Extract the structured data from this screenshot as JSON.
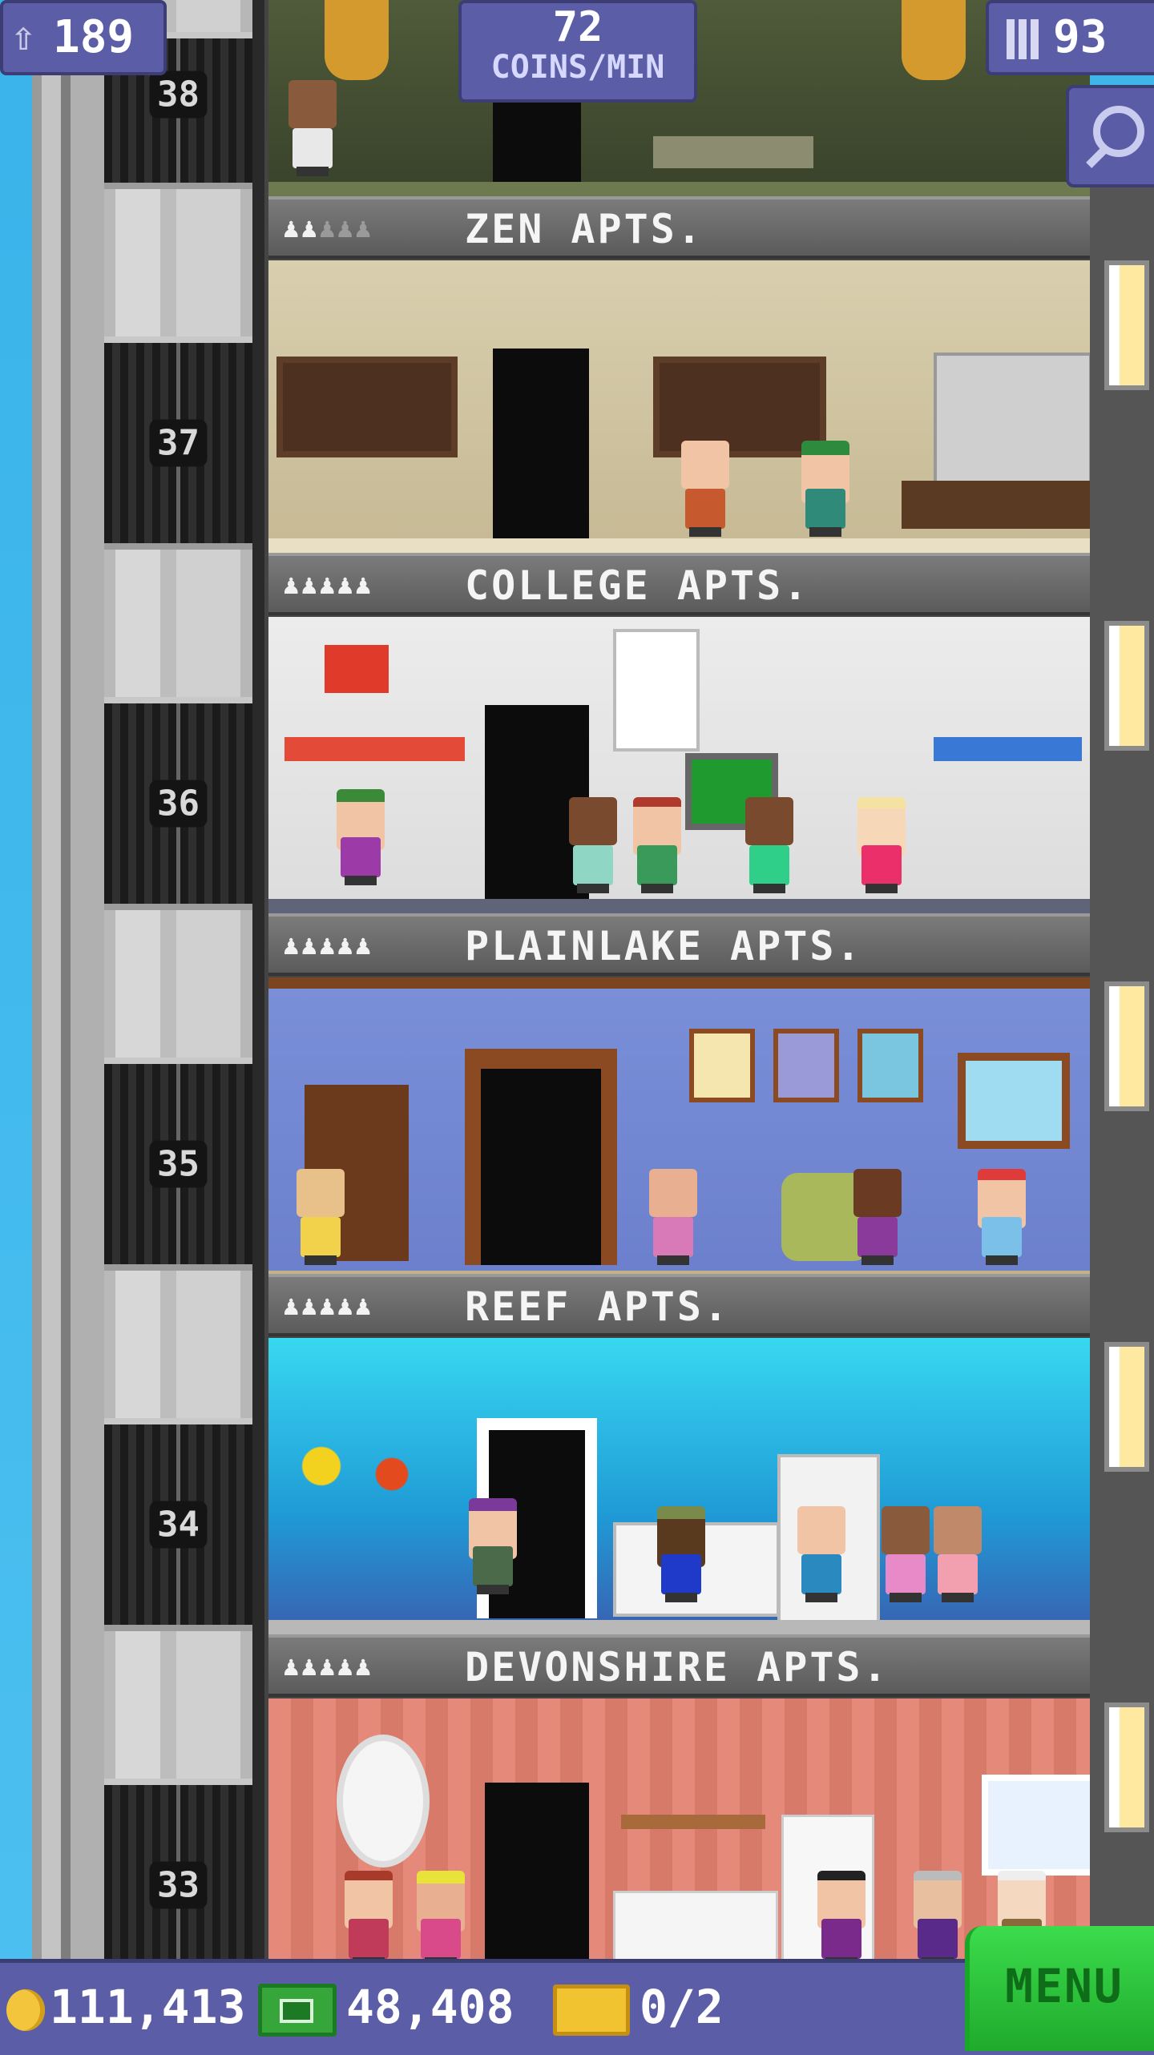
{
  "hud": {
    "population": "189",
    "coins_per_min_value": "72",
    "coins_per_min_label": "COINS/MIN",
    "floor_count": "93",
    "icons": {
      "population": "person-up-icon",
      "floors": "building-icon",
      "search": "magnifier-icon"
    }
  },
  "elevator": {
    "floor_numbers": [
      "38",
      "37",
      "36",
      "35",
      "34",
      "33"
    ]
  },
  "floors": [
    {
      "name": "ZEN APTS.",
      "residents_filled": 2,
      "residents_max": 5
    },
    {
      "name": "COLLEGE APTS.",
      "residents_filled": 5,
      "residents_max": 5
    },
    {
      "name": "PLAINLAKE APTS.",
      "residents_filled": 5,
      "residents_max": 5
    },
    {
      "name": "REEF APTS.",
      "residents_filled": 5,
      "residents_max": 5
    },
    {
      "name": "DEVONSHIRE APTS.",
      "residents_filled": 5,
      "residents_max": 5
    }
  ],
  "bottom_bar": {
    "coins": "111,413",
    "bux": "48,408",
    "tickets": "0/2",
    "menu_label": "MENU"
  },
  "colors": {
    "hud_panel": "#5b5ea6",
    "menu_green": "#2ecb3f",
    "sky": "#3fb6ea"
  }
}
